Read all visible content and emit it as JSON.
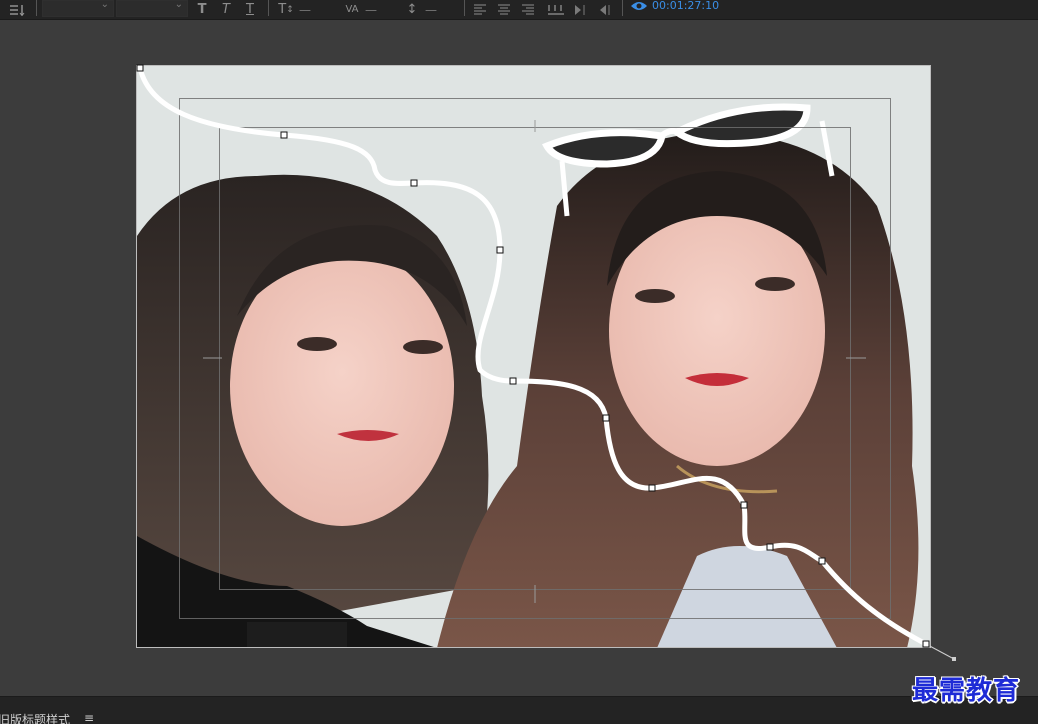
{
  "toolbar": {
    "timecode": "00:01:27:10",
    "tools": [
      {
        "name": "list-icon",
        "glyph": "≡↕"
      },
      {
        "name": "bold-icon",
        "glyph": "T"
      },
      {
        "name": "italic-icon",
        "glyph": "T"
      },
      {
        "name": "underline-icon",
        "glyph": "T̲"
      },
      {
        "name": "font-size-icon",
        "glyph": "T↕"
      },
      {
        "name": "kerning-icon",
        "glyph": "VA"
      },
      {
        "name": "leading-icon",
        "glyph": "↕"
      },
      {
        "name": "align-left-icon",
        "glyph": "☰"
      },
      {
        "name": "align-center-icon",
        "glyph": "☰"
      },
      {
        "name": "align-right-icon",
        "glyph": "☰"
      },
      {
        "name": "tab-stops-icon",
        "glyph": "⚏"
      },
      {
        "name": "roll-icon",
        "glyph": "▶|"
      },
      {
        "name": "crawl-icon",
        "glyph": "◀|"
      },
      {
        "name": "eye-icon",
        "glyph": "◉"
      }
    ],
    "dash": "—"
  },
  "canvas": {
    "background": "#3c3c3c",
    "path_color": "#ffffff"
  },
  "bottom_panel": {
    "title": "旧版标题样式",
    "menu_icon": "≡"
  },
  "watermark": {
    "text": "最需教育",
    "color": "#1e2bd6"
  }
}
